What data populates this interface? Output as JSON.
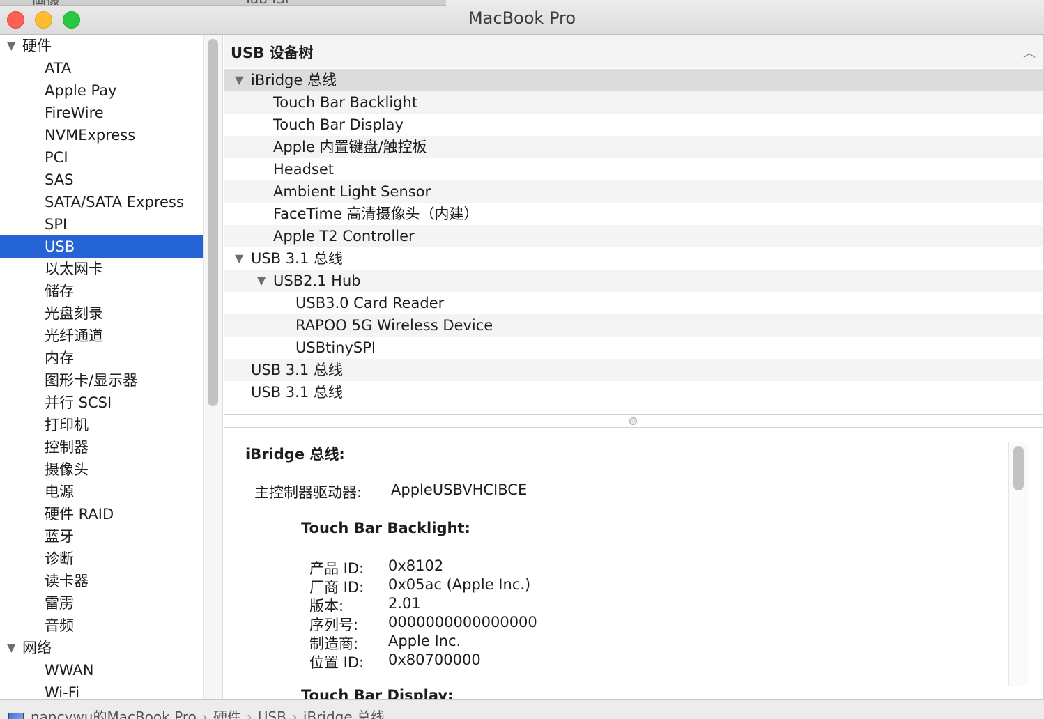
{
  "window": {
    "title": "MacBook Pro",
    "behind_tabs": [
      "画像",
      "Tab ISP"
    ]
  },
  "sidebar": {
    "groups": [
      {
        "label": "硬件",
        "items": [
          "ATA",
          "Apple Pay",
          "FireWire",
          "NVMExpress",
          "PCI",
          "SAS",
          "SATA/SATA Express",
          "SPI",
          "USB",
          "以太网卡",
          "储存",
          "光盘刻录",
          "光纤通道",
          "内存",
          "图形卡/显示器",
          "并行 SCSI",
          "打印机",
          "控制器",
          "摄像头",
          "电源",
          "硬件 RAID",
          "蓝牙",
          "诊断",
          "读卡器",
          "雷雳",
          "音频"
        ]
      },
      {
        "label": "网络",
        "items": [
          "WWAN",
          "Wi-Fi"
        ]
      }
    ],
    "selected": "USB"
  },
  "tree": {
    "header": "USB 设备树",
    "rows": [
      {
        "label": "iBridge 总线",
        "level": 0,
        "expanded": true
      },
      {
        "label": "Touch Bar Backlight",
        "level": 1
      },
      {
        "label": "Touch Bar Display",
        "level": 1
      },
      {
        "label": "Apple 内置键盘/触控板",
        "level": 1
      },
      {
        "label": "Headset",
        "level": 1
      },
      {
        "label": "Ambient Light Sensor",
        "level": 1
      },
      {
        "label": "FaceTime 高清摄像头（内建）",
        "level": 1
      },
      {
        "label": "Apple T2 Controller",
        "level": 1
      },
      {
        "label": "USB 3.1 总线",
        "level": 0,
        "expanded": true
      },
      {
        "label": "USB2.1 Hub",
        "level": 1,
        "expanded": true
      },
      {
        "label": "USB3.0 Card Reader",
        "level": 2
      },
      {
        "label": "RAPOO 5G Wireless Device",
        "level": 2
      },
      {
        "label": "USBtinySPI",
        "level": 2
      },
      {
        "label": "USB 3.1 总线",
        "level": 0
      },
      {
        "label": "USB 3.1 总线",
        "level": 0
      }
    ]
  },
  "detail": {
    "title": "iBridge 总线:",
    "host_label": "主控制器驱动器:",
    "host_value": "AppleUSBVHCIBCE",
    "device_title": "Touch Bar Backlight:",
    "fields": [
      {
        "label": "产品 ID:",
        "value": "0x8102"
      },
      {
        "label": "厂商 ID:",
        "value": "0x05ac (Apple Inc.)"
      },
      {
        "label": "版本:",
        "value": "2.01"
      },
      {
        "label": "序列号:",
        "value": "0000000000000000"
      },
      {
        "label": "制造商:",
        "value": "Apple Inc."
      },
      {
        "label": "位置 ID:",
        "value": "0x80700000"
      }
    ],
    "next_title": "Touch Bar Display:"
  },
  "statusbar": {
    "path": [
      "nancywu的MacBook Pro",
      "硬件",
      "USB",
      "iBridge 总线"
    ]
  },
  "colors": {
    "selection": "#2464d4",
    "close": "#fe5f57",
    "minimize": "#febc2e",
    "maximize": "#28c840"
  }
}
